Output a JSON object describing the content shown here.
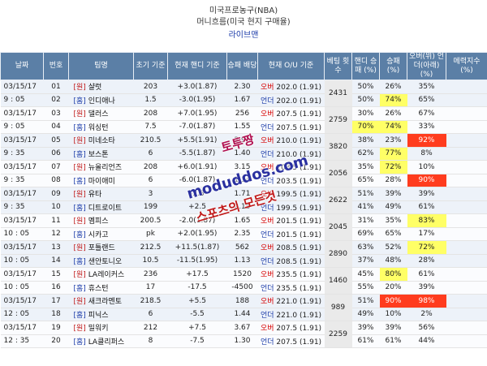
{
  "header": {
    "league": "미국프로농구(NBA)",
    "subtitle": "머니흐름(미국 현지 구매율)",
    "link": "라이브맨"
  },
  "columns": [
    "날짜",
    "번호",
    "팀명",
    "초기 기준",
    "현재 핸디 기준",
    "승패 배당",
    "현재 O/U 기준",
    "베팅 횟수",
    "핸디 승패 (%)",
    "승패 (%)",
    "오버(위) 언더(아래) (%)",
    "메력지수 (%)"
  ],
  "rows": [
    {
      "date": "03/15/17",
      "no": "01",
      "tag": "[원]",
      "team": "샬럿",
      "init": "203",
      "handi": "+3.0(1.87)",
      "odds": "2.30",
      "ou_type": "오버",
      "ou": "202.0 (1.91)",
      "total": "2431",
      "hp": "50%",
      "wl": "26%",
      "ouv": "35%",
      "mg": ""
    },
    {
      "date": "9 : 05",
      "no": "02",
      "tag": "[홈]",
      "team": "인디애나",
      "init": "1.5",
      "handi": "-3.0(1.95)",
      "odds": "1.67",
      "ou_type": "언더",
      "ou": "202.0 (1.91)",
      "total": "",
      "hp": "50%",
      "wl": "74%",
      "ouv": "65%",
      "mg": ""
    },
    {
      "date": "03/15/17",
      "no": "03",
      "tag": "[원]",
      "team": "댈러스",
      "init": "208",
      "handi": "+7.0(1.95)",
      "odds": "256",
      "ou_type": "오버",
      "ou": "207.5 (1.91)",
      "total": "2759",
      "hp": "30%",
      "wl": "26%",
      "ouv": "67%",
      "mg": ""
    },
    {
      "date": "9 : 05",
      "no": "04",
      "tag": "[홈]",
      "team": "워싱턴",
      "init": "7.5",
      "handi": "-7.0(1.87)",
      "odds": "1.55",
      "ou_type": "언더",
      "ou": "207.5 (1.91)",
      "total": "",
      "hp": "70%",
      "wl": "74%",
      "ouv": "33%",
      "mg": ""
    },
    {
      "date": "03/15/17",
      "no": "05",
      "tag": "[원]",
      "team": "미네소타",
      "init": "210.5",
      "handi": "+5.5(1.91)",
      "odds": "2.95",
      "ou_type": "오버",
      "ou": "210.0 (1.91)",
      "total": "3820",
      "hp": "38%",
      "wl": "23%",
      "ouv": "92%",
      "mg": ""
    },
    {
      "date": "9 : 35",
      "no": "06",
      "tag": "[홈]",
      "team": "보스톤",
      "init": "6",
      "handi": "-5.5(1.87)",
      "odds": "1.40",
      "ou_type": "언더",
      "ou": "210.0 (1.91)",
      "total": "",
      "hp": "62%",
      "wl": "77%",
      "ouv": "8%",
      "mg": ""
    },
    {
      "date": "03/15/17",
      "no": "07",
      "tag": "[원]",
      "team": "뉴올리언즈",
      "init": "208",
      "handi": "+6.0(1.91)",
      "odds": "3.15",
      "ou_type": "오버",
      "ou": "203.5 (1.91)",
      "total": "2056",
      "hp": "35%",
      "wl": "72%",
      "ouv": "10%",
      "mg": ""
    },
    {
      "date": "9 : 35",
      "no": "08",
      "tag": "[홈]",
      "team": "마이애미",
      "init": "6",
      "handi": "-6.0(1.87)",
      "odds": "1.34",
      "ou_type": "언더",
      "ou": "203.5 (1.91)",
      "total": "",
      "hp": "65%",
      "wl": "28%",
      "ouv": "90%",
      "mg": ""
    },
    {
      "date": "03/15/17",
      "no": "09",
      "tag": "[원]",
      "team": "유타",
      "init": "3",
      "handi": "-2.5",
      "odds": "1.71",
      "ou_type": "오버",
      "ou": "199.5 (1.91)",
      "total": "2622",
      "hp": "51%",
      "wl": "39%",
      "ouv": "39%",
      "mg": ""
    },
    {
      "date": "9 : 35",
      "no": "10",
      "tag": "[홈]",
      "team": "디트로이트",
      "init": "199",
      "handi": "+2.5",
      "odds": "2.15",
      "ou_type": "언더",
      "ou": "199.5 (1.91)",
      "total": "",
      "hp": "41%",
      "wl": "49%",
      "ouv": "61%",
      "mg": ""
    },
    {
      "date": "03/15/17",
      "no": "11",
      "tag": "[원]",
      "team": "멤피스",
      "init": "200.5",
      "handi": "-2.0(1.87)",
      "odds": "1.65",
      "ou_type": "오버",
      "ou": "201.5 (1.91)",
      "total": "2045",
      "hp": "31%",
      "wl": "35%",
      "ouv": "83%",
      "mg": ""
    },
    {
      "date": "10 : 05",
      "no": "12",
      "tag": "[홈]",
      "team": "시카고",
      "init": "pk",
      "handi": "+2.0(1.95)",
      "odds": "2.35",
      "ou_type": "언더",
      "ou": "201.5 (1.91)",
      "total": "",
      "hp": "69%",
      "wl": "65%",
      "ouv": "17%",
      "mg": ""
    },
    {
      "date": "03/15/17",
      "no": "13",
      "tag": "[원]",
      "team": "포틀랜드",
      "init": "212.5",
      "handi": "+11.5(1.87)",
      "odds": "562",
      "ou_type": "오버",
      "ou": "208.5 (1.91)",
      "total": "2890",
      "hp": "63%",
      "wl": "52%",
      "ouv": "72%",
      "mg": ""
    },
    {
      "date": "10 : 05",
      "no": "14",
      "tag": "[홈]",
      "team": "샌안토니오",
      "init": "10.5",
      "handi": "-11.5(1.95)",
      "odds": "1.13",
      "ou_type": "언더",
      "ou": "208.5 (1.91)",
      "total": "",
      "hp": "37%",
      "wl": "48%",
      "ouv": "28%",
      "mg": ""
    },
    {
      "date": "03/15/17",
      "no": "15",
      "tag": "[원]",
      "team": "LA레이커스",
      "init": "236",
      "handi": "+17.5",
      "odds": "1520",
      "ou_type": "오버",
      "ou": "235.5 (1.91)",
      "total": "1460",
      "hp": "45%",
      "wl": "80%",
      "ouv": "61%",
      "mg": ""
    },
    {
      "date": "10 : 05",
      "no": "16",
      "tag": "[홈]",
      "team": "휴스턴",
      "init": "17",
      "handi": "-17.5",
      "odds": "-4500",
      "ou_type": "언더",
      "ou": "235.5 (1.91)",
      "total": "",
      "hp": "55%",
      "wl": "20%",
      "ouv": "39%",
      "mg": ""
    },
    {
      "date": "03/15/17",
      "no": "17",
      "tag": "[원]",
      "team": "새크라멘토",
      "init": "218.5",
      "handi": "+5.5",
      "odds": "188",
      "ou_type": "오버",
      "ou": "221.0 (1.91)",
      "total": "989",
      "hp": "51%",
      "wl": "90%",
      "ouv": "98%",
      "mg": ""
    },
    {
      "date": "12 : 05",
      "no": "18",
      "tag": "[홈]",
      "team": "피닉스",
      "init": "6",
      "handi": "-5.5",
      "odds": "1.44",
      "ou_type": "언더",
      "ou": "221.0 (1.91)",
      "total": "",
      "hp": "49%",
      "wl": "10%",
      "ouv": "2%",
      "mg": ""
    },
    {
      "date": "03/15/17",
      "no": "19",
      "tag": "[원]",
      "team": "밀워키",
      "init": "212",
      "handi": "+7.5",
      "odds": "3.67",
      "ou_type": "오버",
      "ou": "207.5 (1.91)",
      "total": "2259",
      "hp": "39%",
      "wl": "39%",
      "ouv": "56%",
      "mg": ""
    },
    {
      "date": "12 : 35",
      "no": "20",
      "tag": "[홈]",
      "team": "LA클리퍼스",
      "init": "8",
      "handi": "-7.5",
      "odds": "1.30",
      "ou_type": "언더",
      "ou": "207.5 (1.91)",
      "total": "",
      "hp": "61%",
      "wl": "61%",
      "ouv": "44%",
      "mg": ""
    }
  ],
  "highlights": {
    "hp": {
      "3": "yellow"
    },
    "wl": {
      "1": "yellow",
      "3": "yellow",
      "5": "yellow",
      "6": "yellow",
      "14": "yellow",
      "16": "red"
    },
    "ouv": {
      "4": "red",
      "7": "red",
      "10": "yellow",
      "12": "yellow",
      "16": "red"
    }
  },
  "watermarks": [
    "토투짱",
    "moduddos.com",
    "스포츠의 모든것"
  ],
  "colors": {
    "header_bg": "#5b7fa6",
    "over": "#d60000",
    "under": "#1a3aa8",
    "highlight_yellow": "#ffff66",
    "highlight_red": "#ff3c1e"
  }
}
